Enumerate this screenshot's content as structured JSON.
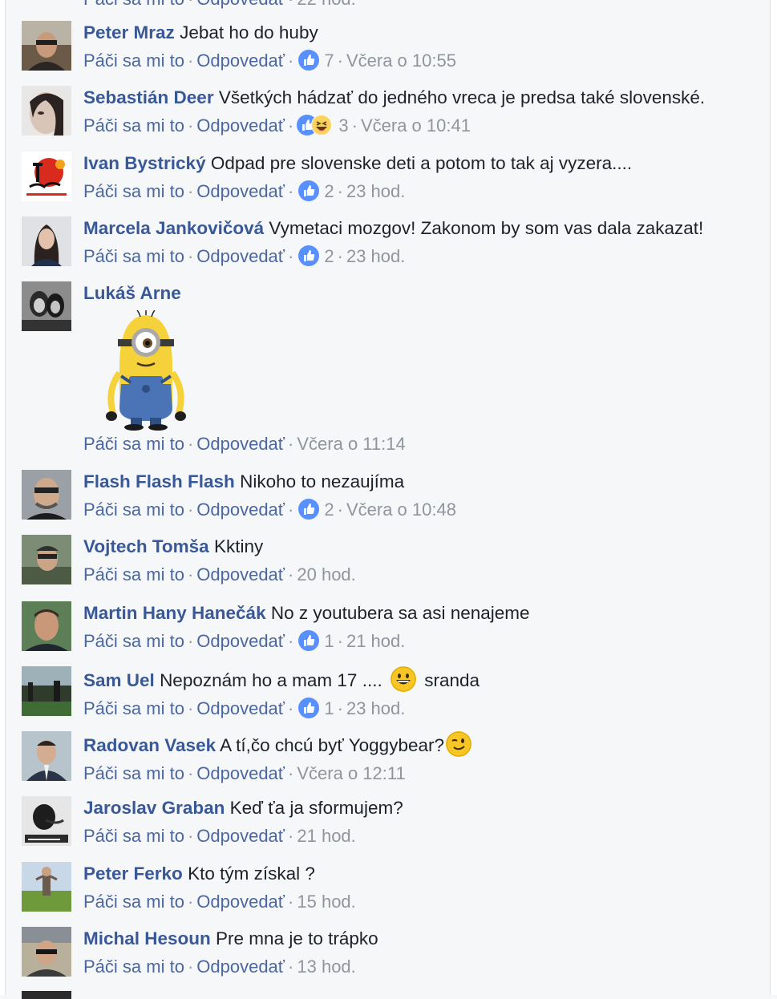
{
  "clipped_top": {
    "like": "Páči sa mi to",
    "reply": "Odpovedať",
    "time": "22 hod."
  },
  "actions": {
    "like": "Páči sa mi to",
    "reply": "Odpovedať"
  },
  "comments": [
    {
      "author": "Peter Mraz",
      "text": "Jebat ho do huby",
      "reactions": "7",
      "time": "Včera o 10:55"
    },
    {
      "author": "Sebastián Deer",
      "text": "Všetkých hádzať do jedného vreca je predsa také slovenské.",
      "reactions": "3",
      "time": "Včera o 10:41"
    },
    {
      "author": "Ivan Bystrický",
      "text": "Odpad pre slovenske deti a potom to tak aj vyzera....",
      "reactions": "2",
      "time": "23 hod."
    },
    {
      "author": "Marcela Jankovičová",
      "text": "Vymetaci mozgov! Zakonom by som vas dala zakazat!",
      "reactions": "2",
      "time": "23 hod."
    },
    {
      "author": "Lukáš Arne",
      "text": "",
      "reactions": "",
      "time": "Včera o 11:14"
    },
    {
      "author": "Flash Flash Flash",
      "text": "Nikoho to nezaujíma",
      "reactions": "2",
      "time": "Včera o 10:48"
    },
    {
      "author": "Vojtech Tomša",
      "text": "Kktiny",
      "reactions": "",
      "time": "20 hod."
    },
    {
      "author": "Martin Hany Hanečák",
      "text": "No z youtubera sa asi nenajeme",
      "reactions": "1",
      "time": "21 hod."
    },
    {
      "author": "Sam Uel",
      "text": "Nepoznám ho a mam 17 ....",
      "text_after": "sranda",
      "reactions": "1",
      "time": "23 hod."
    },
    {
      "author": "Radovan Vasek",
      "text": "A tí,čo chcú byť Yoggybear?",
      "reactions": "",
      "time": "Včera o 12:11"
    },
    {
      "author": "Jaroslav Graban",
      "text": "Keď ťa ja sformujem?",
      "reactions": "",
      "time": "21 hod."
    },
    {
      "author": "Peter Ferko",
      "text": "Kto tým získal ?",
      "reactions": "",
      "time": "15 hod."
    },
    {
      "author": "Michal Hesoun",
      "text": "Pre mna je to trápko",
      "reactions": "",
      "time": "13 hod."
    }
  ],
  "colors": {
    "author": "#385898",
    "action": "#4b67a1",
    "meta": "#90949c",
    "like_blue": "#5890ff",
    "background": "#f6f7f9"
  },
  "icons": [
    "like-reaction-icon",
    "haha-reaction-icon",
    "grin-emoji-icon",
    "wink-emoji-icon",
    "minion-sticker"
  ]
}
